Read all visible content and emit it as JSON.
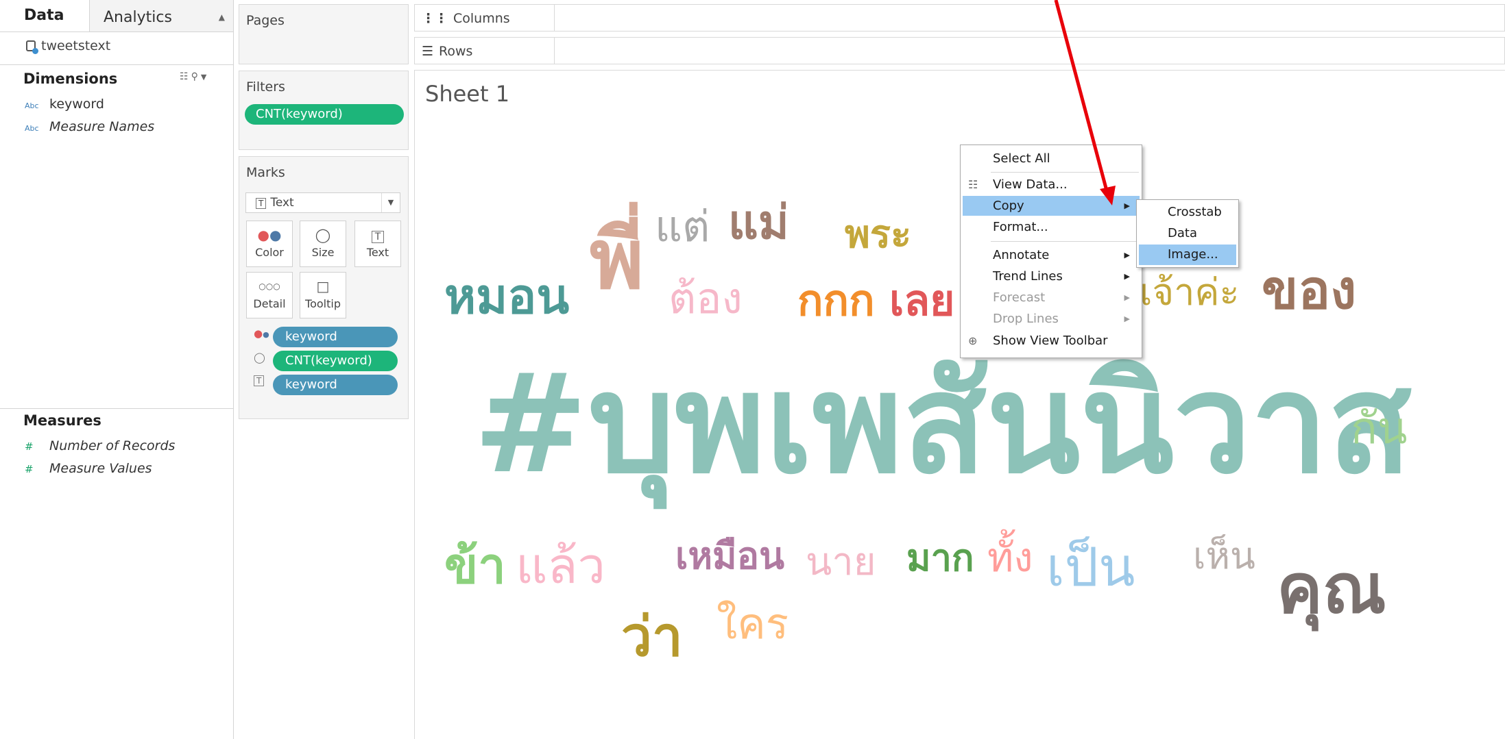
{
  "tabs": {
    "data": "Data",
    "analytics": "Analytics"
  },
  "datasource": "tweetstext",
  "dimensions": {
    "title": "Dimensions",
    "fields": [
      {
        "type": "Abc",
        "name": "keyword"
      },
      {
        "type": "Abc",
        "name": "Measure Names"
      }
    ]
  },
  "measures": {
    "title": "Measures",
    "fields": [
      {
        "type": "#",
        "name": "Number of Records"
      },
      {
        "type": "#",
        "name": "Measure Values"
      }
    ]
  },
  "pages": {
    "title": "Pages"
  },
  "filters": {
    "title": "Filters",
    "pill": "CNT(keyword)"
  },
  "marks": {
    "title": "Marks",
    "type": "Text",
    "buttons": [
      "Color",
      "Size",
      "Text",
      "Detail",
      "Tooltip"
    ],
    "pills": [
      "keyword",
      "CNT(keyword)",
      "keyword"
    ]
  },
  "shelves": {
    "columns": "Columns",
    "rows": "Rows"
  },
  "sheet": {
    "title": "Sheet 1"
  },
  "wordcloud": {
    "words": [
      {
        "text": "#บุพเพสันนิวาส",
        "color": "#8cc2b8"
      },
      {
        "text": "พี่",
        "color": "#d7aa98"
      },
      {
        "text": "แต่",
        "color": "#a9a9a9"
      },
      {
        "text": "แม่",
        "color": "#a07d6e"
      },
      {
        "text": "พระ",
        "color": "#c4a73b"
      },
      {
        "text": "หมอน",
        "color": "#4d9a95"
      },
      {
        "text": "ต้อง",
        "color": "#f6b8c9"
      },
      {
        "text": "กกก",
        "color": "#f28e2b"
      },
      {
        "text": "เลย",
        "color": "#e15759"
      },
      {
        "text": "เจ้าค่ะ",
        "color": "#c4a73b"
      },
      {
        "text": "ของ",
        "color": "#9c755f"
      },
      {
        "text": "กัน",
        "color": "#a0d28e"
      },
      {
        "text": "ข้า",
        "color": "#8cd17d"
      },
      {
        "text": "แล้ว",
        "color": "#f9b7c8"
      },
      {
        "text": "เหมือน",
        "color": "#b07aa1"
      },
      {
        "text": "นาย",
        "color": "#f3b8c6"
      },
      {
        "text": "มาก",
        "color": "#59a14f"
      },
      {
        "text": "ทั้ง",
        "color": "#ff9d9a"
      },
      {
        "text": "เป็น",
        "color": "#9ecae9"
      },
      {
        "text": "เห็น",
        "color": "#bab0ac"
      },
      {
        "text": "คุณ",
        "color": "#79706e"
      },
      {
        "text": "ว่า",
        "color": "#b6992d"
      },
      {
        "text": "ใคร",
        "color": "#ffbe7d"
      }
    ]
  },
  "context_menu": {
    "items": [
      {
        "label": "Select All"
      },
      {
        "label": "View Data...",
        "icon": "table-icon"
      },
      {
        "label": "Copy",
        "highlighted": true,
        "submenu": true
      },
      {
        "label": "Format..."
      },
      {
        "label": "Annotate",
        "submenu": true
      },
      {
        "label": "Trend Lines",
        "submenu": true
      },
      {
        "label": "Forecast",
        "disabled": true,
        "submenu": true
      },
      {
        "label": "Drop Lines",
        "disabled": true,
        "submenu": true
      },
      {
        "label": "Show View Toolbar",
        "icon": "zoom-icon"
      }
    ]
  },
  "copy_submenu": {
    "items": [
      {
        "label": "Crosstab"
      },
      {
        "label": "Data"
      },
      {
        "label": "Image...",
        "highlighted": true
      }
    ]
  },
  "annotation_arrow_color": "#e8000a"
}
